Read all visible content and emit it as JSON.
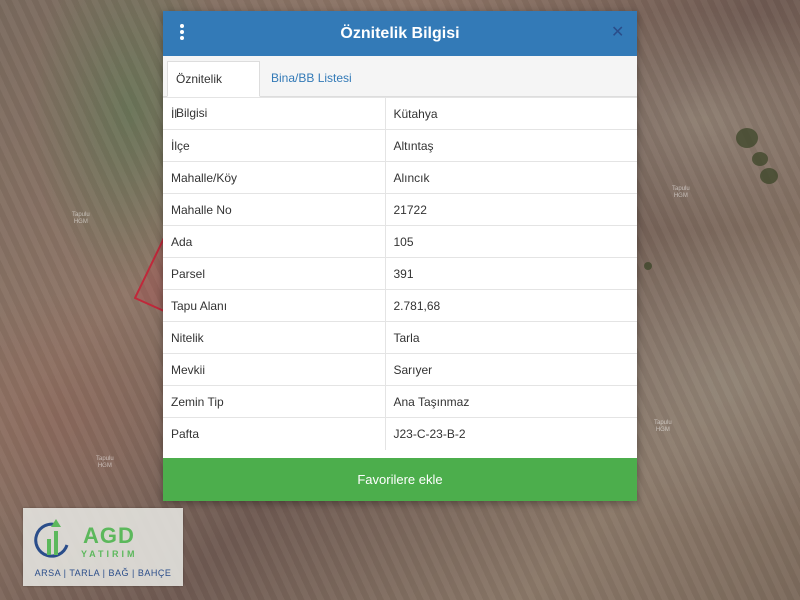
{
  "dialog": {
    "title": "Öznitelik Bilgisi",
    "close_symbol": "✕"
  },
  "tabs": [
    {
      "label": "Öznitelik Bilgisi",
      "active": true
    },
    {
      "label": "Bina/BB Listesi",
      "active": false
    }
  ],
  "attributes": [
    {
      "key": "İl",
      "value": "Kütahya"
    },
    {
      "key": "İlçe",
      "value": "Altıntaş"
    },
    {
      "key": "Mahalle/Köy",
      "value": "Alıncık"
    },
    {
      "key": "Mahalle No",
      "value": "21722"
    },
    {
      "key": "Ada",
      "value": "105"
    },
    {
      "key": "Parsel",
      "value": "391"
    },
    {
      "key": "Tapu Alanı",
      "value": "2.781,68"
    },
    {
      "key": "Nitelik",
      "value": "Tarla"
    },
    {
      "key": "Mevkii",
      "value": "Sarıyer"
    },
    {
      "key": "Zemin Tip",
      "value": "Ana Taşınmaz"
    },
    {
      "key": "Pafta",
      "value": "J23-C-23-B-2"
    }
  ],
  "favorite_button": "Favorilere ekle",
  "map_labels": [
    {
      "line1": "Tapulu",
      "line2": "HGM"
    },
    {
      "line1": "Tapulu",
      "line2": "HGM"
    },
    {
      "line1": "Tapulu",
      "line2": "HGM"
    },
    {
      "line1": "Tapulu",
      "line2": "HGM"
    }
  ],
  "logo": {
    "name": "AGD",
    "sub": "YATIRIM",
    "tagline": "ARSA | TARLA | BAĞ | BAHÇE"
  },
  "colors": {
    "header": "#337ab7",
    "button": "#4cae4c",
    "parcel": "#c0283a",
    "logo_green": "#5cb85c",
    "logo_blue": "#2a4d8a"
  },
  "icons": {
    "menu": "vertical-ellipsis-icon",
    "close": "close-icon"
  }
}
